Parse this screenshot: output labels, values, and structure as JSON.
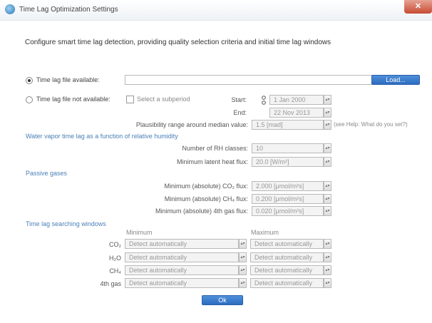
{
  "window": {
    "title": "Time Lag Optimization Settings",
    "close": "✕"
  },
  "intro": "Configure smart time lag detection, providing quality selection criteria and initial time lag windows",
  "timelag_file": {
    "available_label": "Time lag file available:",
    "file_path": "",
    "load_label": "Load...",
    "not_available_label": "Time lag file not available:",
    "subperiod_label": "Select a subperiod",
    "start_label": "Start:",
    "start_value": "1 Jan 2000",
    "end_label": "End:",
    "end_value": "22 Nov 2013",
    "plausibility_label": "Plausibility range around median value:",
    "plausibility_value": "1.5 [mad]",
    "plausibility_note": "(see Help: What do you set?)"
  },
  "rh": {
    "section_title": "Water vapor time lag as a function of relative humidity",
    "classes_label": "Number of RH classes:",
    "classes_value": "10",
    "heat_label": "Minimum latent heat flux:",
    "heat_value": "20.0 [W/m²]"
  },
  "passive": {
    "section_title": "Passive gases",
    "co2_label": "Minimum (absolute) CO₂ flux:",
    "co2_value": "2.000 [μmol/m²s]",
    "ch4_label": "Minimum (absolute) CH₄ flux:",
    "ch4_value": "0.200 [μmol/m²s]",
    "gas4_label": "Minimum (absolute) 4th gas flux:",
    "gas4_value": "0.020 [μmol/m²s]"
  },
  "windows": {
    "section_title": "Time lag searching windows",
    "min_header": "Minimum",
    "max_header": "Maximum",
    "rows": [
      {
        "gas": "CO₂",
        "min": "Detect automatically",
        "max": "Detect automatically"
      },
      {
        "gas": "H₂O",
        "min": "Detect automatically",
        "max": "Detect automatically"
      },
      {
        "gas": "CH₄",
        "min": "Detect automatically",
        "max": "Detect automatically"
      },
      {
        "gas": "4th gas",
        "min": "Detect automatically",
        "max": "Detect automatically"
      }
    ]
  },
  "ok_label": "Ok"
}
